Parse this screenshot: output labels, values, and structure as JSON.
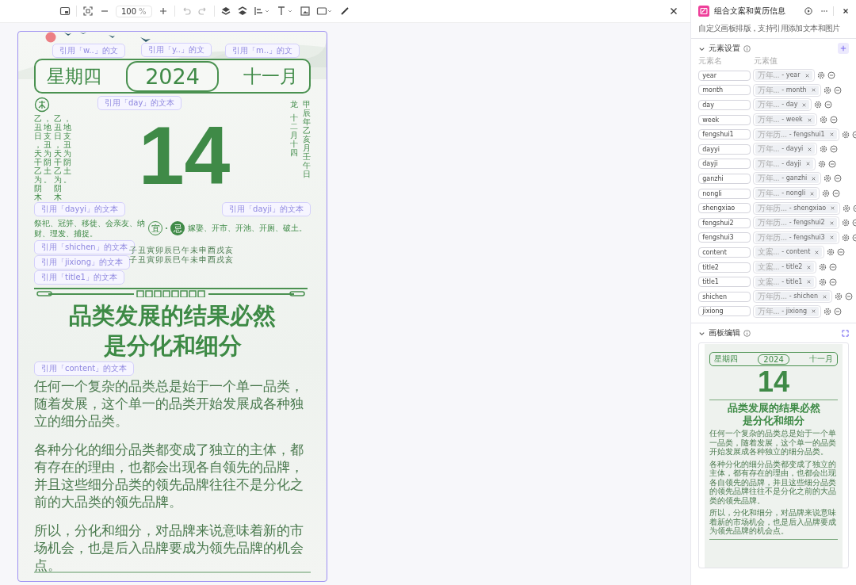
{
  "toolbar": {
    "zoom": "100",
    "zoom_unit": "%"
  },
  "card": {
    "week": "星期四",
    "year": "2024",
    "month": "十一月",
    "day": "14",
    "fengshui_left": [
      "乙丑日，天干乙为阴木，地支丑为阴土。",
      "乙丑日，天干乙为阴木，地支丑为阴土。"
    ],
    "zodiac": "龙",
    "lunar_date": "十二月十四",
    "ganzhi": "甲辰年乙亥月壬午日",
    "yi_label": "宜",
    "yi": "祭祀、冠笄、移徙、会亲友、纳财、理发、捕捉。",
    "ji_label": "忌",
    "ji": "嫁娶、开市、开池、开厕、破土。",
    "shichen": [
      "子丑寅卯辰巳午未申酉戌亥",
      "子丑寅卯辰巳午未申酉戌亥"
    ],
    "title_lines": [
      "品类发展的结果必然",
      "是分化和细分"
    ],
    "paragraphs": [
      "任何一个复杂的品类总是始于一个单一品类，随着发展，这个单一的品类开始发展成各种独立的细分品类。",
      "各种分化的细分品类都变成了独立的主体，都有存在的理由，也都会出现各自领先的品牌，并且这些细分品类的领先品牌往往不是分化之前的大品类的领先品牌。",
      "所以，分化和细分，对品牌来说意味着新的市场机会，也是后入品牌要成为领先品牌的机会点。"
    ]
  },
  "reference_tags": [
    "引用「w..」的文",
    "引用「y..」的文",
    "引用「m..」的文",
    "引用「day」的文本",
    "引用「dayyi」的文本",
    "引用「dayji」的文本",
    "引用「shichen」的文本",
    "引用「jixiong」的文本",
    "引用「title1」的文本",
    "引用「content」的文本"
  ],
  "panel": {
    "title": "组合文案和黄历信息",
    "subtitle": "自定义画板排版，支持引用添加文本和图片",
    "elements_section": {
      "title": "元素设置",
      "columns": [
        "元素名",
        "元素值"
      ],
      "rows": [
        {
          "name": "year",
          "source": "万年...",
          "value": "- year"
        },
        {
          "name": "month",
          "source": "万年...",
          "value": "- month"
        },
        {
          "name": "day",
          "source": "万年...",
          "value": "- day"
        },
        {
          "name": "week",
          "source": "万年...",
          "value": "- week"
        },
        {
          "name": "fengshui1",
          "source": "万年历...",
          "value": "- fengshui1"
        },
        {
          "name": "dayyi",
          "source": "万年...",
          "value": "- dayyi"
        },
        {
          "name": "dayji",
          "source": "万年...",
          "value": "- dayji"
        },
        {
          "name": "ganzhi",
          "source": "万年...",
          "value": "- ganzhi"
        },
        {
          "name": "nongli",
          "source": "万年...",
          "value": "- nongli"
        },
        {
          "name": "shengxiao",
          "source": "万年历...",
          "value": "- shengxiao"
        },
        {
          "name": "fengshui2",
          "source": "万年历...",
          "value": "- fengshui2"
        },
        {
          "name": "fengshui3",
          "source": "万年历...",
          "value": "- fengshui3"
        },
        {
          "name": "content",
          "source": "文案...",
          "value": "- content"
        },
        {
          "name": "title2",
          "source": "文案...",
          "value": "- title2"
        },
        {
          "name": "title1",
          "source": "文案...",
          "value": "- title1"
        },
        {
          "name": "shichen",
          "source": "万年历...",
          "value": "- shichen"
        },
        {
          "name": "jixiong",
          "source": "万年...",
          "value": "- jixiong"
        }
      ]
    },
    "board_section": {
      "title": "画板编辑"
    }
  },
  "preview": {
    "week": "星期四",
    "year": "2024",
    "month": "十一月",
    "day": "14",
    "title_lines": [
      "品类发展的结果必然",
      "是分化和细分"
    ],
    "paragraphs": [
      "任何一个复杂的品类总是始于一个单一品类，随着发展，这个单一的品类开始发展成各种独立的细分品类。",
      "各种分化的细分品类都变成了独立的主体，都有存在的理由，也都会出现各自领先的品牌，并且这些细分品类的领先品牌往往不是分化之前的大品类的领先品牌。",
      "所以，分化和细分，对品牌来说意味着新的市场机会，也是后入品牌要成为领先品牌的机会点。"
    ]
  }
}
